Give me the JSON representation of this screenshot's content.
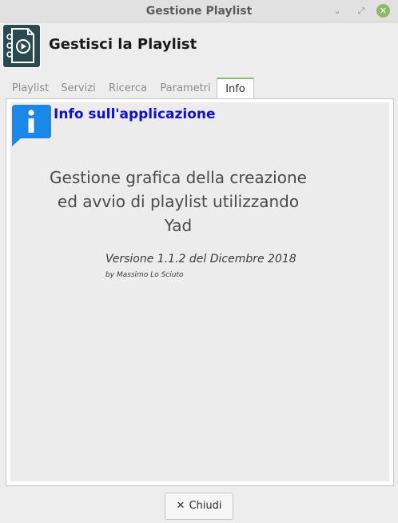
{
  "window": {
    "title": "Gestione Playlist",
    "buttons": {
      "minimize_glyph": "⌄",
      "maximize_glyph": "⤢",
      "close_glyph": "✕"
    }
  },
  "header": {
    "icon": "playlist-document-icon",
    "title": "Gestisci la Playlist"
  },
  "tabs": [
    {
      "label": "Playlist",
      "active": false
    },
    {
      "label": "Servizi",
      "active": false
    },
    {
      "label": "Ricerca",
      "active": false
    },
    {
      "label": "Parametri",
      "active": false
    },
    {
      "label": "Info",
      "active": true
    }
  ],
  "info": {
    "icon": "info-icon",
    "title": "Info sull'applicazione",
    "description_lines": [
      "Gestione grafica della creazione",
      "ed avvio di playlist utilizzando",
      "Yad"
    ],
    "version": "Versione 1.1.2 del Dicembre 2018",
    "author": "by Massimo Lo Sciuto"
  },
  "footer": {
    "close_icon": "✕",
    "close_label": "Chiudi"
  },
  "colors": {
    "accent": "#8fb96b",
    "info_title": "#1010c8",
    "info_badge": "#1b87e6",
    "icon_dark": "#2b4a4e"
  }
}
